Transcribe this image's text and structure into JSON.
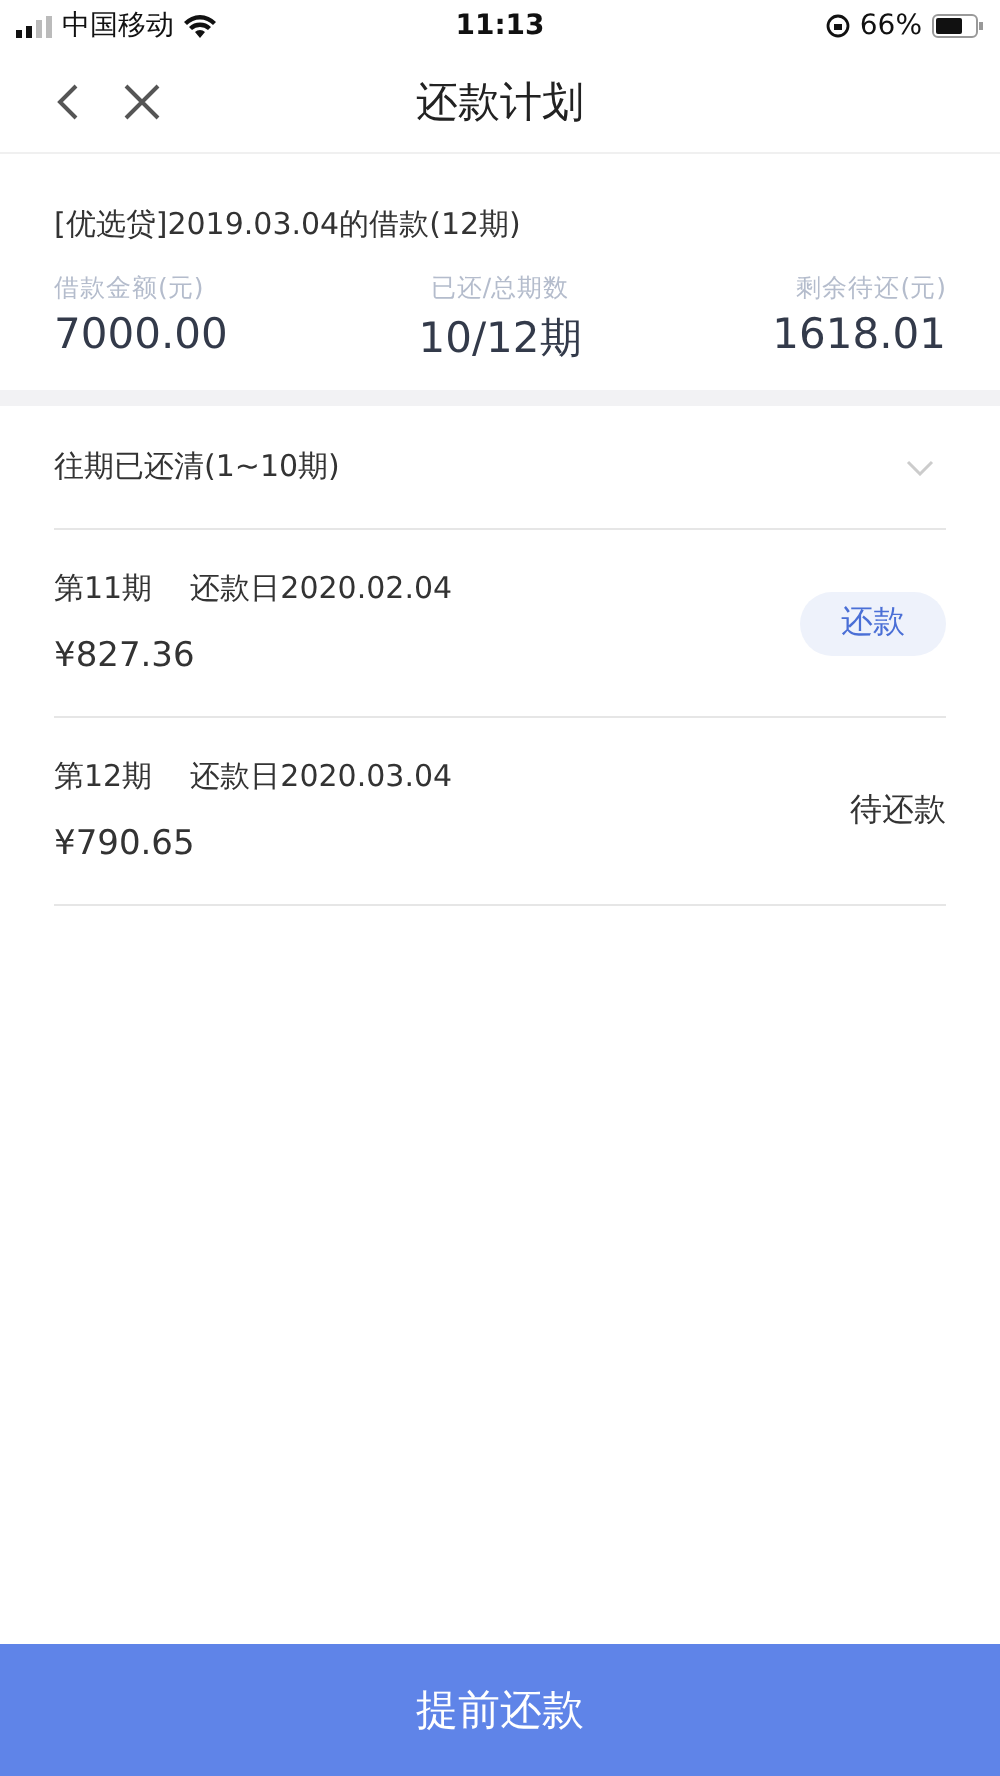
{
  "status_bar": {
    "carrier": "中国移动",
    "time": "11:13",
    "battery": "66%"
  },
  "nav": {
    "title": "还款计划"
  },
  "loan": {
    "title": "[优选贷]2019.03.04的借款(12期)",
    "stats": [
      {
        "label": "借款金额(元)",
        "value": "7000.00"
      },
      {
        "label": "已还/总期数",
        "value": "10/12期"
      },
      {
        "label": "剩余待还(元)",
        "value": "1618.01"
      }
    ]
  },
  "paid_section": {
    "label": "往期已还清(1~10期)",
    "expanded": false
  },
  "installments": [
    {
      "period": "第11期",
      "due": "还款日2020.02.04",
      "amount": "¥827.36",
      "kind": "button",
      "action": "还款"
    },
    {
      "period": "第12期",
      "due": "还款日2020.03.04",
      "amount": "¥790.65",
      "kind": "status",
      "action": "待还款"
    }
  ],
  "footer_button": "提前还款"
}
